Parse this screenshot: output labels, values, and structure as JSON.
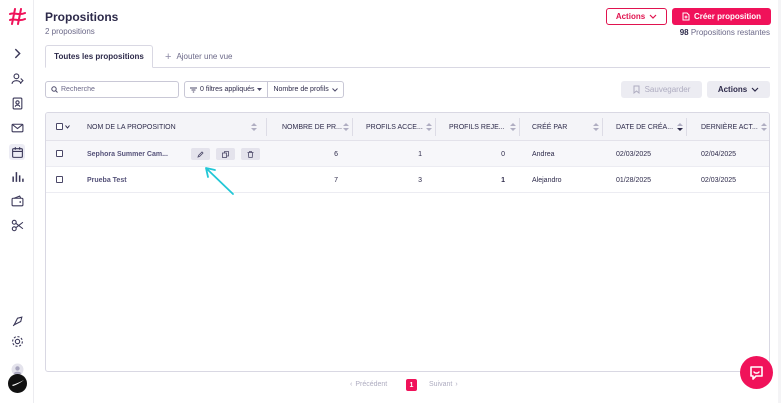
{
  "header": {
    "title": "Propositions",
    "subtitle": "2 propositions",
    "actions_label": "Actions",
    "create_label": "Créer proposition",
    "remaining_count": "98",
    "remaining_label": "Propositions restantes"
  },
  "tabs": {
    "active_label": "Toutes les propositions",
    "add_view_label": "Ajouter une vue"
  },
  "toolbar": {
    "search_placeholder": "Recherche",
    "filters_label": "0 filtres appliqués",
    "profile_count_label": "Nombre de profils",
    "save_label": "Sauvegarder",
    "actions_label": "Actions"
  },
  "table": {
    "columns": [
      "NOM DE LA PROPOSITION",
      "NOMBRE DE PR...",
      "PROFILS ACCE...",
      "PROFILS REJE...",
      "CRÉÉ PAR",
      "DATE DE CRÉA...",
      "DERNIÈRE ACT..."
    ],
    "rows": [
      {
        "name": "Sephora Summer Cam...",
        "profiles": "6",
        "accepted": "1",
        "rejected": "0",
        "created_by": "Andrea",
        "created_date": "02/03/2025",
        "last_activity": "02/04/2025"
      },
      {
        "name": "Prueba Test",
        "profiles": "7",
        "accepted": "3",
        "rejected": "1",
        "created_by": "Alejandro",
        "created_date": "01/28/2025",
        "last_activity": "02/03/2025"
      }
    ]
  },
  "pagination": {
    "prev_label": "Précédent",
    "current_page": "1",
    "next_label": "Suivant"
  },
  "colors": {
    "brand": "#f0125a",
    "arrow": "#22c7d6",
    "text": "#2d2a4a"
  },
  "icons": {
    "sidebar": [
      "logo-icon",
      "chevron-right-icon",
      "users-icon",
      "contact-card-icon",
      "mail-icon",
      "calendar-icon",
      "bar-chart-icon",
      "wallet-icon",
      "scissors-icon",
      "rocket-icon",
      "settings-icon",
      "avatar-icon",
      "brand-logo-icon"
    ]
  }
}
